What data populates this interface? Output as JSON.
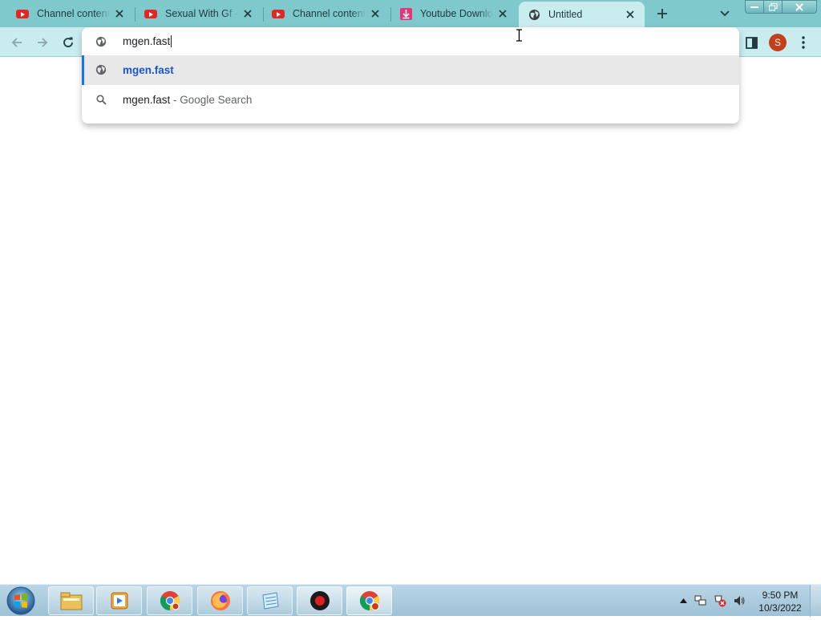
{
  "tabs": [
    {
      "title": "Channel content",
      "favicon": "youtube-icon"
    },
    {
      "title": "Sexual With Gf - Y",
      "favicon": "youtube-icon"
    },
    {
      "title": "Channel content",
      "favicon": "youtube-icon"
    },
    {
      "title": "Youtube Downloader",
      "favicon": "download-icon"
    },
    {
      "title": "Untitled",
      "favicon": "globe-icon",
      "active": true
    }
  ],
  "omnibox": {
    "input_value": "mgen.fast",
    "suggestions": [
      {
        "text": "mgen.fast",
        "icon": "globe-icon",
        "selected": true
      },
      {
        "text": "mgen.fast",
        "suffix": "- Google Search",
        "icon": "search-icon"
      }
    ]
  },
  "profile": {
    "initial": "S",
    "color": "#c5401a"
  },
  "colors": {
    "tabstrip": "#7fc8cc",
    "toolbar": "#c9ecef",
    "accent": "#1a73e8"
  },
  "taskbar": {
    "apps": [
      "windows-explorer-icon",
      "media-player-icon",
      "chrome-icon",
      "firefox-icon",
      "notepad-icon",
      "recorder-icon",
      "chrome-profile-icon"
    ],
    "clock": {
      "time": "9:50 PM",
      "date": "10/3/2022"
    }
  }
}
